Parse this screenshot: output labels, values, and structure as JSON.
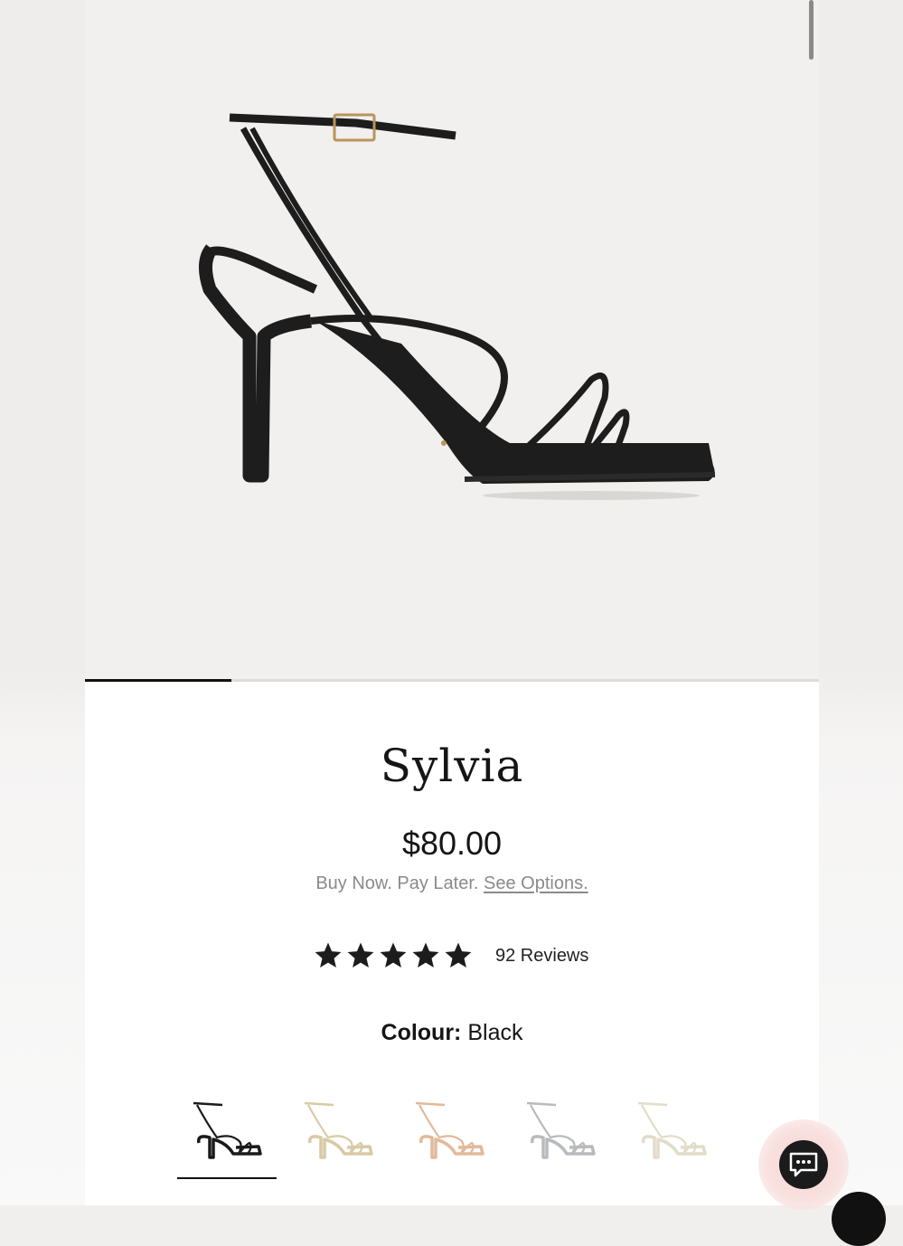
{
  "product": {
    "name": "Sylvia",
    "price": "$80.00",
    "bnpl_text": "Buy Now. Pay Later.",
    "bnpl_link": "See Options.",
    "rating_stars": 5,
    "reviews_label": "92 Reviews",
    "colour_label": "Colour:",
    "colour_value": "Black"
  },
  "gallery": {
    "progress_fraction": 0.2
  },
  "swatches": [
    {
      "color": "#1a1a1a",
      "selected": true
    },
    {
      "color": "#d9c9a6",
      "selected": false
    },
    {
      "color": "#e3b99c",
      "selected": false
    },
    {
      "color": "#b9babd",
      "selected": false
    },
    {
      "color": "#e2dcc8",
      "selected": false
    }
  ],
  "icons": {
    "chat": "chat-bubble-icon",
    "star": "star-icon"
  }
}
